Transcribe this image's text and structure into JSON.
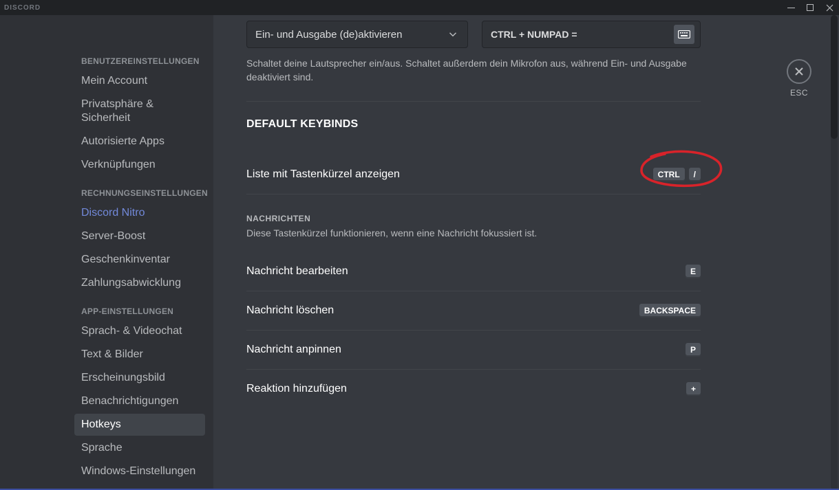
{
  "app": {
    "logo": "DISCORD"
  },
  "close": {
    "label": "ESC"
  },
  "sidebar": {
    "sections": [
      {
        "title": "BENUTZEREINSTELLUNGEN",
        "items": [
          "Mein Account",
          "Privatsphäre & Sicherheit",
          "Autorisierte Apps",
          "Verknüpfungen"
        ]
      },
      {
        "title": "RECHNUNGSEINSTELLUNGEN",
        "items": [
          "Discord Nitro",
          "Server-Boost",
          "Geschenkinventar",
          "Zahlungsabwicklung"
        ]
      },
      {
        "title": "APP-EINSTELLUNGEN",
        "items": [
          "Sprach- & Videochat",
          "Text & Bilder",
          "Erscheinungsbild",
          "Benachrichtigungen",
          "Hotkeys",
          "Sprache",
          "Windows-Einstellungen"
        ]
      }
    ]
  },
  "top_action": {
    "select_value": "Ein- und Ausgabe (de)aktivieren",
    "keybind_value": "CTRL + NUMPAD =",
    "description": "Schaltet deine Lautsprecher ein/aus. Schaltet außerdem dein Mikrofon aus, während Ein- und Ausgabe deaktiviert sind."
  },
  "default_section_title": "DEFAULT KEYBINDS",
  "rows_top": [
    {
      "label": "Liste mit Tastenkürzel anzeigen",
      "keys": [
        "CTRL",
        "/"
      ]
    }
  ],
  "messages_section": {
    "title": "NACHRICHTEN",
    "desc": "Diese Tastenkürzel funktionieren, wenn eine Nachricht fokussiert ist."
  },
  "rows_msg": [
    {
      "label": "Nachricht bearbeiten",
      "keys": [
        "E"
      ]
    },
    {
      "label": "Nachricht löschen",
      "keys": [
        "BACKSPACE"
      ]
    },
    {
      "label": "Nachricht anpinnen",
      "keys": [
        "P"
      ]
    },
    {
      "label": "Reaktion hinzufügen",
      "keys": [
        "+"
      ]
    }
  ]
}
